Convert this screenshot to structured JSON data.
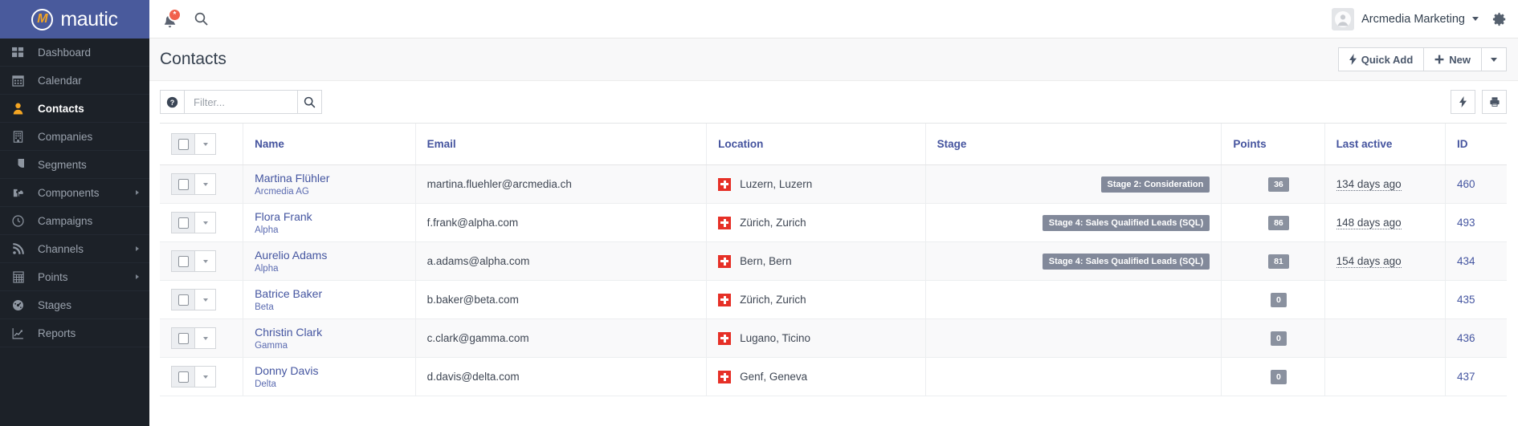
{
  "brand": {
    "name": "mautic",
    "mark_letter": "M"
  },
  "sidebar": {
    "items": [
      {
        "label": "Dashboard",
        "icon": "grid-icon",
        "active": false,
        "has_submenu": false
      },
      {
        "label": "Calendar",
        "icon": "calendar-icon",
        "active": false,
        "has_submenu": false
      },
      {
        "label": "Contacts",
        "icon": "user-icon",
        "active": true,
        "has_submenu": false
      },
      {
        "label": "Companies",
        "icon": "building-icon",
        "active": false,
        "has_submenu": false
      },
      {
        "label": "Segments",
        "icon": "pie-chart-icon",
        "active": false,
        "has_submenu": false
      },
      {
        "label": "Components",
        "icon": "puzzle-icon",
        "active": false,
        "has_submenu": true
      },
      {
        "label": "Campaigns",
        "icon": "clock-icon",
        "active": false,
        "has_submenu": false
      },
      {
        "label": "Channels",
        "icon": "rss-icon",
        "active": false,
        "has_submenu": true
      },
      {
        "label": "Points",
        "icon": "calculator-icon",
        "active": false,
        "has_submenu": true
      },
      {
        "label": "Stages",
        "icon": "gauge-icon",
        "active": false,
        "has_submenu": false
      },
      {
        "label": "Reports",
        "icon": "line-chart-icon",
        "active": false,
        "has_submenu": false
      }
    ]
  },
  "topbar": {
    "notifications_icon": "bell-icon",
    "notifications_badge": "*",
    "search_icon": "search-icon",
    "user_name": "Arcmedia Marketing",
    "avatar_icon": "user-avatar-icon",
    "settings_icon": "gear-icon"
  },
  "page": {
    "title": "Contacts",
    "quick_add_label": "Quick Add",
    "quick_add_icon": "bolt-icon",
    "new_label": "New",
    "new_icon": "plus-icon",
    "dropdown_icon": "chevron-down-icon"
  },
  "toolbar": {
    "help_icon": "question-circle-icon",
    "filter_placeholder": "Filter...",
    "filter_value": "",
    "search_icon": "search-icon",
    "bolt_icon": "bolt-icon",
    "print_icon": "print-icon"
  },
  "table": {
    "columns": [
      "",
      "Name",
      "Email",
      "Location",
      "Stage",
      "Points",
      "Last active",
      "ID"
    ],
    "rows": [
      {
        "name": "Martina Flühler",
        "company": "Arcmedia AG",
        "email": "martina.fluehler@arcmedia.ch",
        "location": "Luzern, Luzern",
        "flag": "swiss-flag-icon",
        "stage": "Stage 2: Consideration",
        "points": "36",
        "last_active": "134 days ago",
        "id": "460"
      },
      {
        "name": "Flora Frank",
        "company": "Alpha",
        "email": "f.frank@alpha.com",
        "location": "Zürich, Zurich",
        "flag": "swiss-flag-icon",
        "stage": "Stage 4: Sales Qualified Leads (SQL)",
        "points": "86",
        "last_active": "148 days ago",
        "id": "493"
      },
      {
        "name": "Aurelio Adams",
        "company": "Alpha",
        "email": "a.adams@alpha.com",
        "location": "Bern, Bern",
        "flag": "swiss-flag-icon",
        "stage": "Stage 4: Sales Qualified Leads (SQL)",
        "points": "81",
        "last_active": "154 days ago",
        "id": "434"
      },
      {
        "name": "Batrice Baker",
        "company": "Beta",
        "email": "b.baker@beta.com",
        "location": "Zürich, Zurich",
        "flag": "swiss-flag-icon",
        "stage": "",
        "points": "0",
        "last_active": "",
        "id": "435"
      },
      {
        "name": "Christin Clark",
        "company": "Gamma",
        "email": "c.clark@gamma.com",
        "location": "Lugano, Ticino",
        "flag": "swiss-flag-icon",
        "stage": "",
        "points": "0",
        "last_active": "",
        "id": "436"
      },
      {
        "name": "Donny Davis",
        "company": "Delta",
        "email": "d.davis@delta.com",
        "location": "Genf, Geneva",
        "flag": "swiss-flag-icon",
        "stage": "",
        "points": "0",
        "last_active": "",
        "id": "437"
      }
    ]
  },
  "colors": {
    "brand_blue": "#495a9c",
    "sidebar_bg": "#1c2128",
    "accent_orange": "#f5a623",
    "link_blue": "#4455a0",
    "badge_red": "#f1604c",
    "stage_gray": "#82899a",
    "flag_red": "#e63027"
  }
}
